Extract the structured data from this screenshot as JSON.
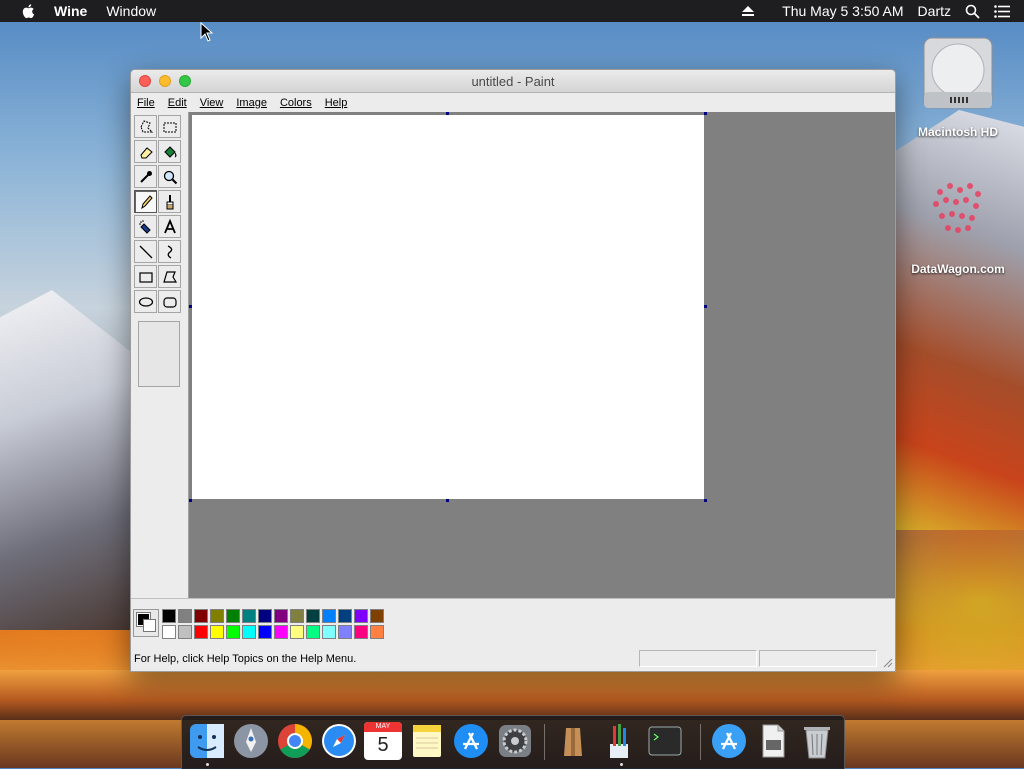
{
  "menubar": {
    "app_name": "Wine",
    "menus": [
      "Window"
    ],
    "clock": "Thu May 5  3:50 AM",
    "user": "Dartz"
  },
  "desktop": {
    "icons": [
      {
        "label": "Macintosh HD",
        "icon": "hard-drive-icon"
      },
      {
        "label": "DataWagon.com",
        "icon": "datawagon-icon"
      }
    ]
  },
  "window": {
    "title": "untitled - Paint",
    "menus": [
      "File",
      "Edit",
      "View",
      "Image",
      "Colors",
      "Help"
    ],
    "tools": [
      "free-select-icon",
      "rect-select-icon",
      "eraser-icon",
      "fill-icon",
      "color-picker-icon",
      "magnifier-icon",
      "pencil-icon",
      "brush-icon",
      "airbrush-icon",
      "text-icon",
      "line-icon",
      "curve-icon",
      "rectangle-icon",
      "polygon-icon",
      "ellipse-icon",
      "rounded-rect-icon"
    ],
    "active_tool": "pencil-icon",
    "primary_color": "#000000",
    "secondary_color": "#ffffff",
    "palette_row1": [
      "#000000",
      "#808080",
      "#800000",
      "#808000",
      "#008000",
      "#008080",
      "#000080",
      "#800080",
      "#808040",
      "#004040",
      "#0080ff",
      "#004080",
      "#8000ff",
      "#804000"
    ],
    "palette_row2": [
      "#ffffff",
      "#c0c0c0",
      "#ff0000",
      "#ffff00",
      "#00ff00",
      "#00ffff",
      "#0000ff",
      "#ff00ff",
      "#ffff80",
      "#00ff80",
      "#80ffff",
      "#8080ff",
      "#ff0080",
      "#ff8040"
    ],
    "status_text": "For Help, click Help Topics on the Help Menu."
  },
  "dock": {
    "items": [
      "finder-icon",
      "launchpad-icon",
      "chrome-icon",
      "safari-icon",
      "calendar-icon",
      "notes-icon",
      "app-store-icon",
      "system-preferences-icon",
      "archive-utility-icon",
      "paint-brushes-icon",
      "terminal-icon",
      "app-store-downloads-icon",
      "document-icon",
      "trash-icon"
    ],
    "calendar_month": "MAY",
    "calendar_day": "5"
  }
}
